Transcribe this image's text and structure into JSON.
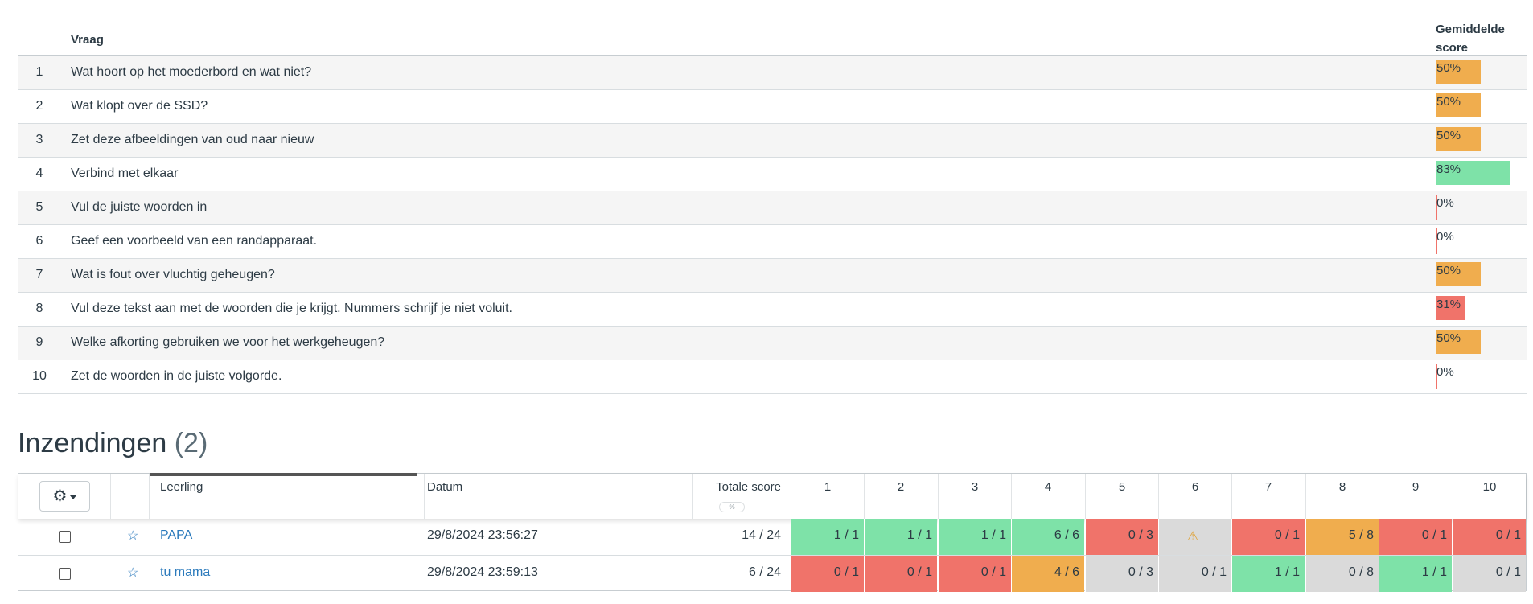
{
  "questions_table": {
    "col_vraag": "Vraag",
    "col_score_line1": "Gemiddelde",
    "col_score_line2": "score",
    "rows": [
      {
        "num": "1",
        "text": "Wat hoort op het moederbord en wat niet?",
        "score_label": "50%",
        "score": 50,
        "color": "#f0ad4e"
      },
      {
        "num": "2",
        "text": "Wat klopt over de SSD?",
        "score_label": "50%",
        "score": 50,
        "color": "#f0ad4e"
      },
      {
        "num": "3",
        "text": "Zet deze afbeeldingen van oud naar nieuw",
        "score_label": "50%",
        "score": 50,
        "color": "#f0ad4e"
      },
      {
        "num": "4",
        "text": "Verbind met elkaar",
        "score_label": "83%",
        "score": 83,
        "color": "#7ee2a8"
      },
      {
        "num": "5",
        "text": "Vul de juiste woorden in",
        "score_label": "0%",
        "score": 0,
        "color": "#f0736a"
      },
      {
        "num": "6",
        "text": "Geef een voorbeeld van een randapparaat.",
        "score_label": "0%",
        "score": 0,
        "color": "#f0736a"
      },
      {
        "num": "7",
        "text": "Wat is fout over vluchtig geheugen?",
        "score_label": "50%",
        "score": 50,
        "color": "#f0ad4e"
      },
      {
        "num": "8",
        "text": "Vul deze tekst aan met de woorden die je krijgt. Nummers schrijf je niet voluit.",
        "score_label": "31%",
        "score": 31,
        "color": "#f0736a"
      },
      {
        "num": "9",
        "text": "Welke afkorting gebruiken we voor het werkgeheugen?",
        "score_label": "50%",
        "score": 50,
        "color": "#f0ad4e"
      },
      {
        "num": "10",
        "text": "Zet de woorden in de juiste volgorde.",
        "score_label": "0%",
        "score": 0,
        "color": "#f0736a"
      }
    ]
  },
  "submissions": {
    "heading": "Inzendingen",
    "count": "(2)",
    "gear_icon": "gear-icon",
    "col_student": "Leerling",
    "col_date": "Datum",
    "col_total": "Totale score",
    "pct_toggle": "%",
    "question_cols": [
      "1",
      "2",
      "3",
      "4",
      "5",
      "6",
      "7",
      "8",
      "9",
      "10"
    ],
    "colors": {
      "green": "#7ee2a8",
      "red": "#f0736a",
      "orange": "#f0ad4e",
      "gray": "#dadada"
    },
    "rows": [
      {
        "name": "PAPA",
        "date": "29/8/2024 23:56:27",
        "total": "14 / 24",
        "cells": [
          {
            "value": "1 / 1",
            "status": "green"
          },
          {
            "value": "1 / 1",
            "status": "green"
          },
          {
            "value": "1 / 1",
            "status": "green"
          },
          {
            "value": "6 / 6",
            "status": "green"
          },
          {
            "value": "0 / 3",
            "status": "red"
          },
          {
            "value": "⚠",
            "status": "gray",
            "warn": true
          },
          {
            "value": "0 / 1",
            "status": "red"
          },
          {
            "value": "5 / 8",
            "status": "orange"
          },
          {
            "value": "0 / 1",
            "status": "red"
          },
          {
            "value": "0 / 1",
            "status": "red"
          }
        ]
      },
      {
        "name": "tu mama",
        "date": "29/8/2024 23:59:13",
        "total": "6 / 24",
        "cells": [
          {
            "value": "0 / 1",
            "status": "red"
          },
          {
            "value": "0 / 1",
            "status": "red"
          },
          {
            "value": "0 / 1",
            "status": "red"
          },
          {
            "value": "4 / 6",
            "status": "orange"
          },
          {
            "value": "0 / 3",
            "status": "gray"
          },
          {
            "value": "0 / 1",
            "status": "gray"
          },
          {
            "value": "1 / 1",
            "status": "green"
          },
          {
            "value": "0 / 8",
            "status": "gray"
          },
          {
            "value": "1 / 1",
            "status": "green"
          },
          {
            "value": "0 / 1",
            "status": "gray"
          }
        ]
      }
    ]
  }
}
